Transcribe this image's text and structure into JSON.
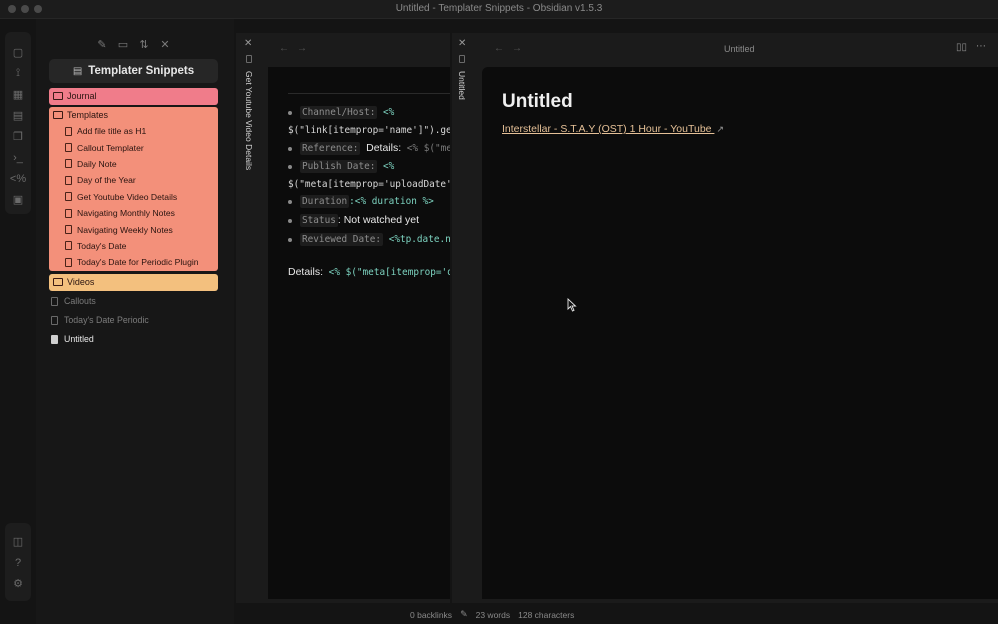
{
  "window": {
    "title": "Untitled - Templater Snippets - Obsidian v1.5.3"
  },
  "ribbon": {
    "top_icons": [
      "files-icon",
      "graph-icon",
      "canvas-icon",
      "calendar-icon",
      "copy-icon",
      "terminal-icon",
      "templater-icon",
      "daily-note-icon"
    ],
    "bottom_icons": [
      "vault-switch-icon",
      "help-icon",
      "settings-icon"
    ]
  },
  "sidebar": {
    "vault_name": "Templater Snippets",
    "folders": {
      "journal": {
        "label": "Journal",
        "color": "#f07c8a"
      },
      "templates": {
        "label": "Templates",
        "color": "#f3907a",
        "files": [
          "Add file title as H1",
          "Callout Templater",
          "Daily Note",
          "Day of the Year",
          "Get Youtube Video Details",
          "Navigating Monthly Notes",
          "Navigating Weekly Notes",
          "Today's Date",
          "Today's Date for Periodic Plugin"
        ]
      },
      "videos": {
        "label": "Videos",
        "color": "#f3c07e"
      }
    },
    "loose_files": [
      "Callouts",
      "Today's Date Periodic",
      "Untitled"
    ]
  },
  "pane_left": {
    "vertical_title": "Get Youtube Video Details",
    "lines": {
      "channel_label": "Channel/Host:",
      "channel_code1": "<%",
      "channel_code2": "$(\"link[itemprop='name']\").get",
      "reference_label": "Reference:",
      "reference_text": "Details:",
      "reference_code": "<% $(\"me",
      "publish_label": "Publish Date:",
      "publish_code1": "<%",
      "publish_code2": "$(\"meta[itemprop='uploadDate']\"",
      "duration_label": "Duration",
      "duration_code": ":<% duration %>",
      "status_label": "Status",
      "status_text": ": Not watched yet",
      "reviewed_label": "Reviewed Date:",
      "reviewed_code": "<%tp.date.n",
      "details_text": "Details:",
      "details_code": "<% $(\"meta[itemprop='de"
    }
  },
  "pane_right": {
    "vertical_title": "Untitled",
    "header_title": "Untitled",
    "doc_title": "Untitled",
    "link_text": "Interstellar - S.T.A.Y (OST) 1 Hour - YouTube"
  },
  "status": {
    "backlinks": "0 backlinks",
    "words": "23 words",
    "characters": "128 characters"
  }
}
